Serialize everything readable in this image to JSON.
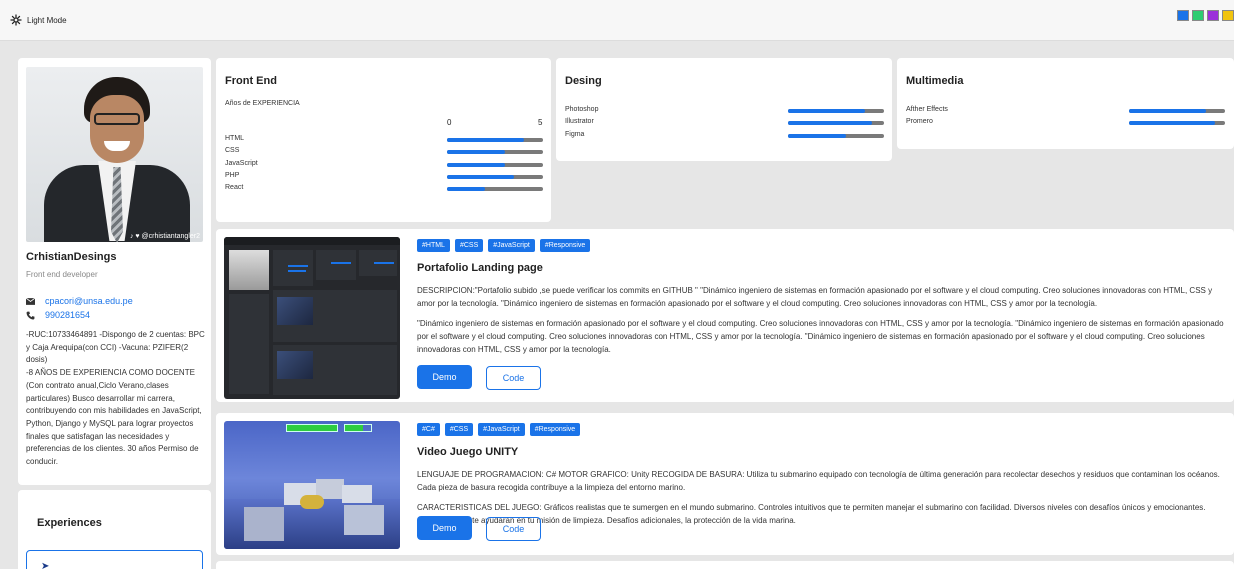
{
  "header": {
    "mode_label": "Light Mode",
    "theme_colors": [
      "#1a73e8",
      "#2ecc71",
      "#9b30d9",
      "#f1c40f"
    ]
  },
  "profile": {
    "name": "CrhistianDesings",
    "role": "Front end developer",
    "photo_handle": "crhistiantangler2",
    "email": "cpacori@unsa.edu.pe",
    "phone": "990281654",
    "bio": "-RUC:10733464891 -Dispongo de 2 cuentas: BPC y Caja Arequipa(con CCI) -Vacuna: PZIFER(2 dosis)\n-8 AÑOS DE EXPERIENCIA COMO DOCENTE (Con contrato anual,Ciclo Verano,clases particulares) Busco desarrollar mi carrera, contribuyendo con mis habilidades en JavaScript, Python, Django y MySQL para lograr proyectos finales que satisfagan las necesidades y preferencias de los clientes. 30 años Permiso de conducir."
  },
  "experiences": {
    "title": "Experiences"
  },
  "skills": {
    "frontend": {
      "title": "Front End",
      "years_label": "Años de EXPERIENCIA",
      "scale_min": "0",
      "scale_max": "5",
      "items": [
        {
          "label": "HTML",
          "level": 0.8
        },
        {
          "label": "CSS",
          "level": 0.6
        },
        {
          "label": "JavaScript",
          "level": 0.6
        },
        {
          "label": "PHP",
          "level": 0.7
        },
        {
          "label": "React",
          "level": 0.4
        }
      ]
    },
    "design": {
      "title": "Desing",
      "items": [
        {
          "label": "Photoshop",
          "level": 0.8
        },
        {
          "label": "Illustrator",
          "level": 0.88
        },
        {
          "label": "Figma",
          "level": 0.6
        }
      ]
    },
    "multimedia": {
      "title": "Multimedia",
      "items": [
        {
          "label": "Afther Effects",
          "level": 0.8
        },
        {
          "label": "Promero",
          "level": 0.9
        }
      ]
    }
  },
  "projects": [
    {
      "tags": [
        "#HTML",
        "#CSS",
        "#JavaScript",
        "#Responsive"
      ],
      "title": "Portafolio Landing page",
      "desc1": "DESCRIPCION:\"Portafolio subido ,se puede verificar los commits en GITHUB \" \"Dinámico ingeniero de sistemas en formación apasionado por el software y el cloud computing. Creo soluciones innovadoras con HTML, CSS y amor por la tecnología. \"Dinámico ingeniero de sistemas en formación apasionado por el software y el cloud computing. Creo soluciones innovadoras con HTML, CSS y amor por la tecnología.",
      "desc2": "\"Dinámico ingeniero de sistemas en formación apasionado por el software y el cloud computing. Creo soluciones innovadoras con HTML, CSS y amor por la tecnología. \"Dinámico ingeniero de sistemas en formación apasionado por el software y el cloud computing. Creo soluciones innovadoras con HTML, CSS y amor por la tecnología. \"Dinámico ingeniero de sistemas en formación apasionado por el software y el cloud computing. Creo soluciones innovadoras con HTML, CSS y amor por la tecnología.",
      "demo_label": "Demo",
      "code_label": "Code"
    },
    {
      "tags": [
        "#C#",
        "#CSS",
        "#JavaScript",
        "#Responsive"
      ],
      "title": "Video Juego UNITY",
      "desc1": "LENGUAJE DE PROGRAMACION: C# MOTOR GRAFICO: Unity RECOGIDA DE BASURA: Utiliza tu submarino equipado con tecnología de última generación para recolectar desechos y residuos que contaminan los océanos. Cada pieza de basura recogida contribuye a la limpieza del entorno marino.",
      "desc2": "CARACTERISTICAS DEL JUEGO: Gráficos realistas que te sumergen en el mundo submarino. Controles intuitivos que te permiten manejar el submarino con facilidad. Diversos niveles con desafíos únicos y emocionantes. submarino que te ayudarán en tu misión de limpieza. Desafíos adicionales, la protección de la vida marina.",
      "demo_label": "Demo",
      "code_label": "Code"
    }
  ]
}
